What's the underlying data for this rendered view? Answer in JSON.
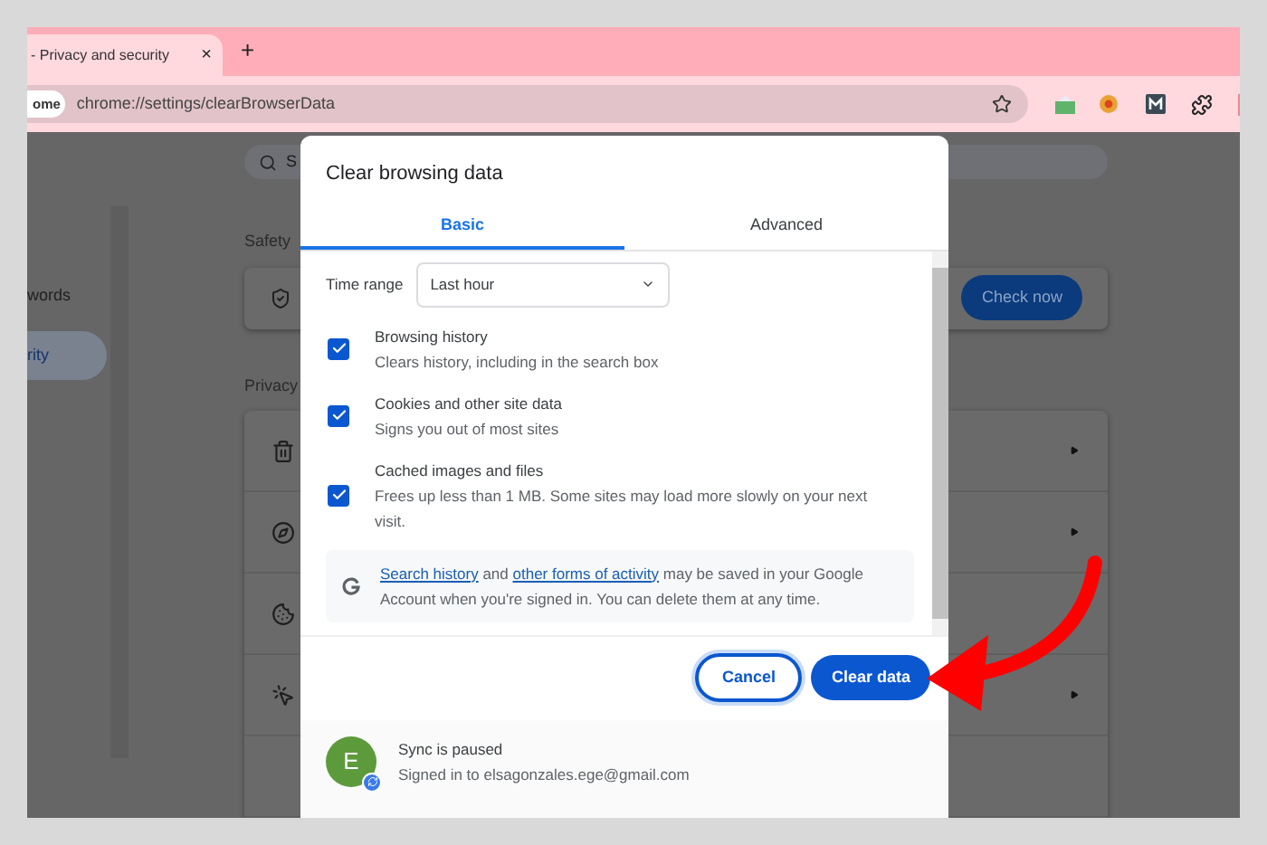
{
  "browser": {
    "tab": {
      "title": "- Privacy and security",
      "close": "×"
    },
    "new_tab": "+",
    "address_bar": {
      "chip": "ome",
      "url": "chrome://settings/clearBrowserData"
    }
  },
  "page": {
    "sidebar_items": [
      {
        "label": "words",
        "selected": false
      },
      {
        "label": "rity",
        "selected": true
      }
    ],
    "search_placeholder": "S",
    "safety_heading": "Safety",
    "check_button": "Check now",
    "privacy_heading": "Privacy",
    "privacy_rows": [
      {
        "kind": "trash"
      },
      {
        "kind": "compass"
      },
      {
        "kind": "cookie"
      },
      {
        "kind": "cursor"
      },
      {
        "kind": "partial"
      }
    ]
  },
  "dialog": {
    "title": "Clear browsing data",
    "tabs": [
      {
        "label": "Basic",
        "selected": true
      },
      {
        "label": "Advanced",
        "selected": false
      }
    ],
    "time_range": {
      "label": "Time range",
      "value": "Last hour"
    },
    "options": [
      {
        "title": "Browsing history",
        "description": "Clears history, including in the search box",
        "checked": true
      },
      {
        "title": "Cookies and other site data",
        "description": "Signs you out of most sites",
        "checked": true
      },
      {
        "title": "Cached images and files",
        "description": "Frees up less than 1 MB. Some sites may load more slowly on your next visit.",
        "checked": true
      }
    ],
    "notice": {
      "link_1": "Search history",
      "middle": " and ",
      "link_2": "other forms of activity",
      "rest": " may be saved in your Google Account when you're signed in. You can delete them at any time."
    },
    "buttons": {
      "cancel": "Cancel",
      "confirm": "Clear data"
    },
    "sync": {
      "avatar_letter": "E",
      "status": "Sync is paused",
      "account": "Signed in to elsagonzales.ege@gmail.com"
    }
  }
}
